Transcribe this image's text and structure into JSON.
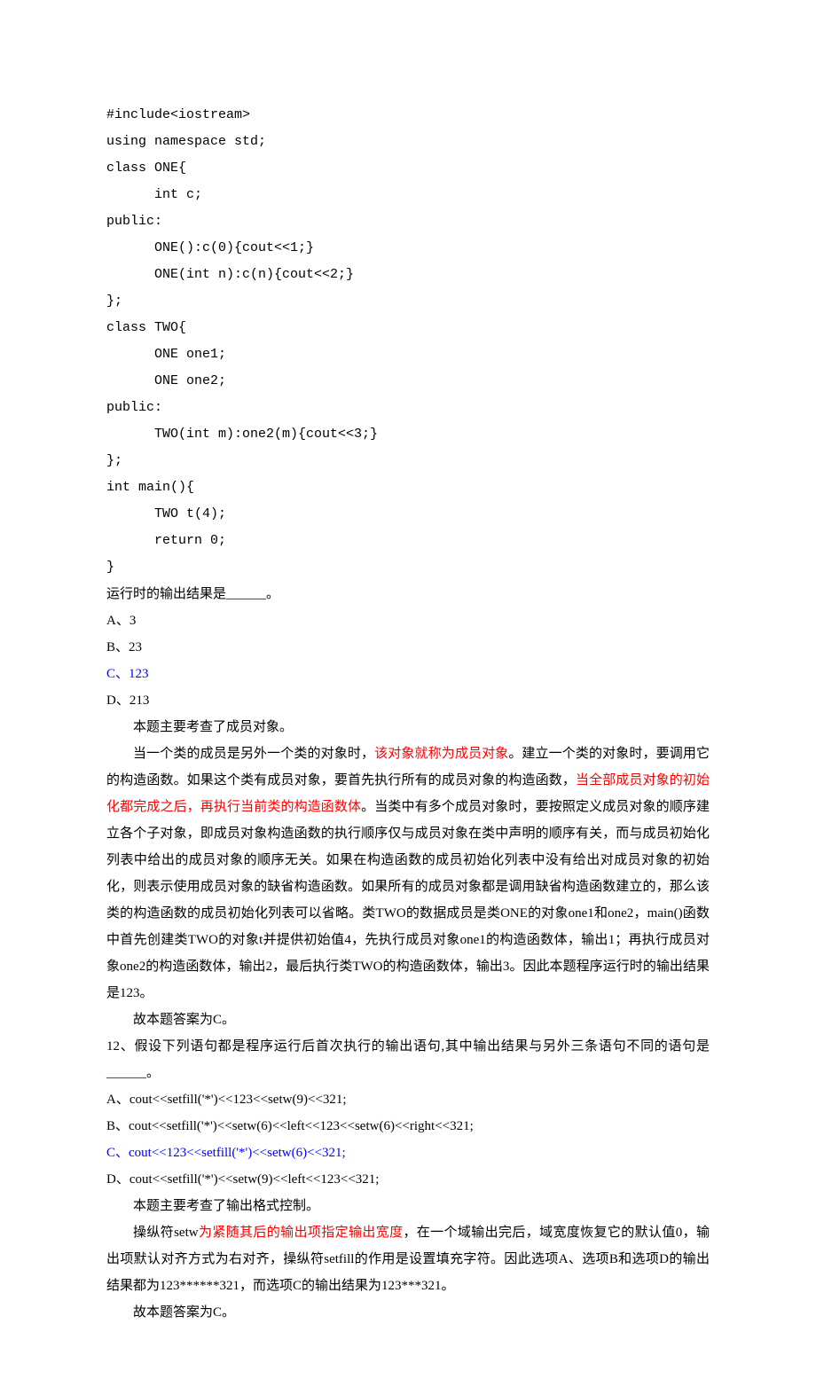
{
  "code": {
    "l1": "#include<iostream>",
    "l2": "using namespace std;",
    "l3": "class ONE{",
    "l4": "      int c;",
    "l5": "public:",
    "l6": "      ONE():c(0){cout<<1;}",
    "l7": "      ONE(int n):c(n){cout<<2;}",
    "l8": "};",
    "l9": "class TWO{",
    "l10": "      ONE one1;",
    "l11": "      ONE one2;",
    "l12": "public:",
    "l13": "      TWO(int m):one2(m){cout<<3;}",
    "l14": "};",
    "l15": "int main(){",
    "l16": "      TWO t(4);",
    "l17": "      return 0;",
    "l18": "}"
  },
  "q11": {
    "stem": "运行时的输出结果是______。",
    "A": "A、3",
    "B": "B、23",
    "C": "C、123",
    "D": "D、213",
    "exp_l1": "本题主要考查了成员对象。",
    "exp_l2a": "当一个类的成员是另外一个类的对象时，",
    "exp_l2b": "该对象就称为成员对象",
    "exp_l2c": "。建立一个类的对象时，要调用它的构造函数。如果这个类有成员对象，要首先执行所有的成员对象的构造函数，",
    "exp_l2d": "当全部成员对象的初始化都完成之后，再执行当前类的构造函数体",
    "exp_l2e": "。当类中有多个成员对象时，要按照定义成员对象的顺序建立各个子对象，即成员对象构造函数的执行顺序仅与成员对象在类中声明的顺序有关，而与成员初始化列表中给出的成员对象的顺序无关。如果在构造函数的成员初始化列表中没有给出对成员对象的初始化，则表示使用成员对象的缺省构造函数。如果所有的成员对象都是调用缺省构造函数建立的，那么该类的构造函数的成员初始化列表可以省略。类TWO的数据成员是类ONE的对象one1和one2，main()函数中首先创建类TWO的对象t并提供初始值4，先执行成员对象one1的构造函数体，输出1；再执行成员对象one2的构造函数体，输出2，最后执行类TWO的构造函数体，输出3。因此本题程序运行时的输出结果是123。",
    "exp_l3": "故本题答案为C。"
  },
  "q12": {
    "stem": "12、假设下列语句都是程序运行后首次执行的输出语句,其中输出结果与另外三条语句不同的语句是______。",
    "A": "A、cout<<setfill('*')<<123<<setw(9)<<321;",
    "B": "B、cout<<setfill('*')<<setw(6)<<left<<123<<setw(6)<<right<<321;",
    "C": "C、cout<<123<<setfill('*')<<setw(6)<<321;",
    "D": "D、cout<<setfill('*')<<setw(9)<<left<<123<<321;",
    "exp_l1": "本题主要考查了输出格式控制。",
    "exp_l2a": "操纵符setw",
    "exp_l2b": "为紧随其后的输出项指定输出宽度",
    "exp_l2c": "，在一个域输出完后，域宽度恢复它的默认值0，输出项默认对齐方式为右对齐，操纵符setfill的作用是设置填充字符。因此选项A、选项B和选项D的输出结果都为123******321，而选项C的输出结果为123***321。",
    "exp_l3": "故本题答案为C。"
  }
}
